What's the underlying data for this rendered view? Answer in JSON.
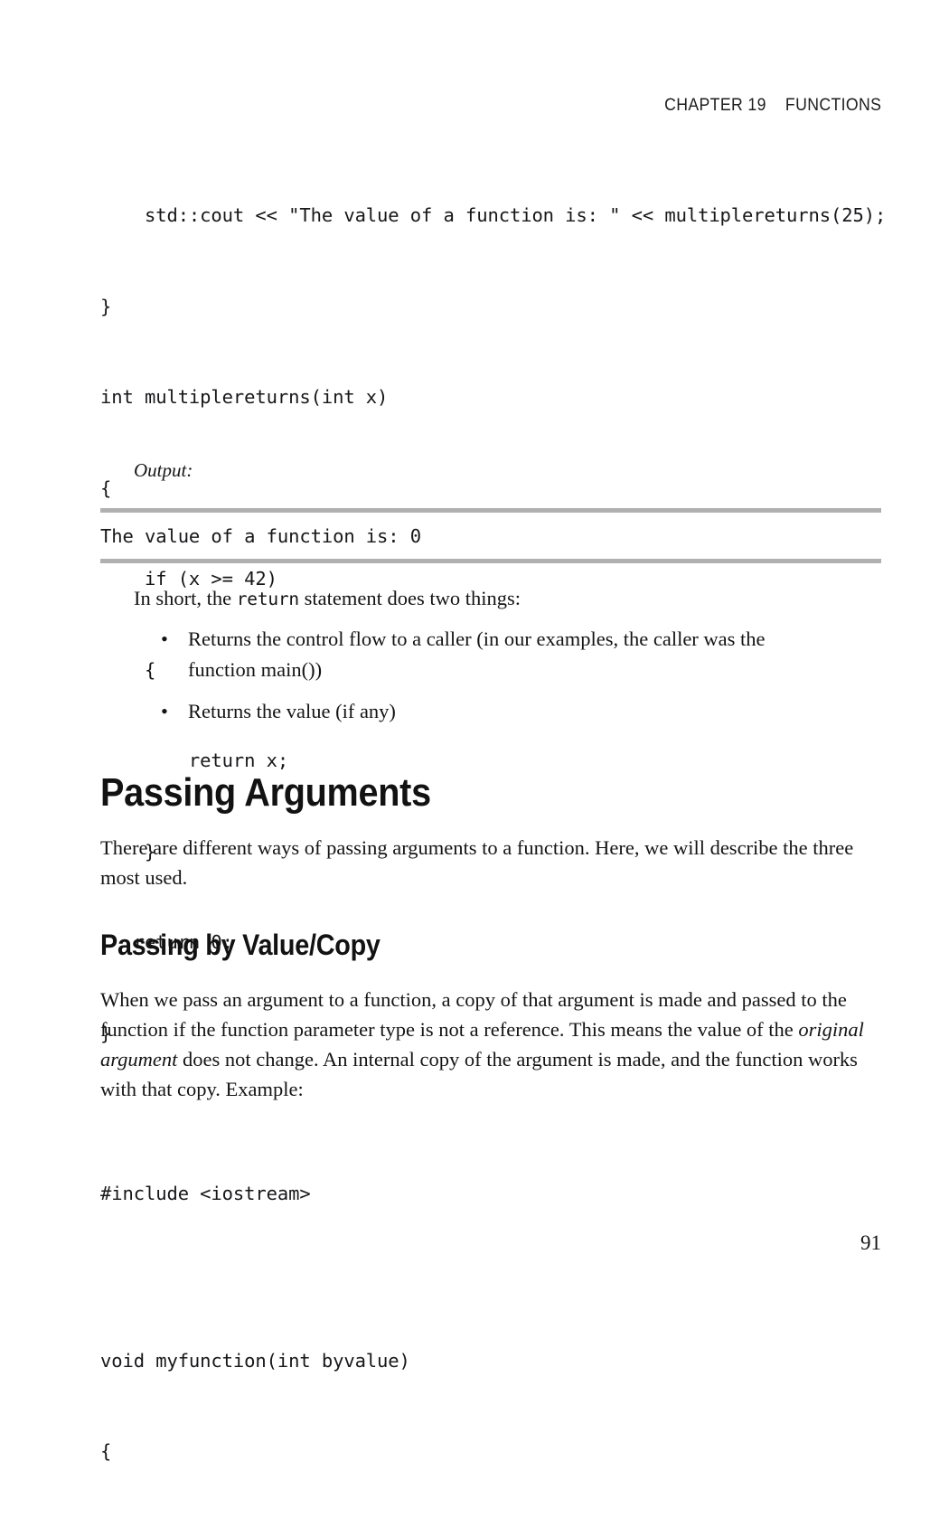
{
  "header": {
    "chapter_label": "CHAPTER 19",
    "chapter_title": "FUNCTIONS",
    "combined": "CHAPTER 19    FUNCTIONS"
  },
  "code_top": {
    "lines": [
      "    std::cout << \"The value of a function is: \" << multiplereturns(25);",
      "}",
      "int multiplereturns(int x)",
      "{",
      "    if (x >= 42)",
      "    {",
      "        return x;",
      "    }",
      "   return 0;",
      "}"
    ]
  },
  "output_section": {
    "label": "Output:",
    "console_text": "The value of a function is: 0",
    "rule_color": "#b0b0b0"
  },
  "intro_paragraph": {
    "before": "In short, the ",
    "code": "return",
    "after": " statement does two things:"
  },
  "bullets": {
    "marker": "•",
    "items": [
      "Returns the control flow to a caller (in our examples, the caller was the function main())",
      "Returns the value (if any)"
    ]
  },
  "section_heading": "Passing Arguments",
  "section_paragraph": "There are different ways of passing arguments to a function. Here, we will describe the three most used.",
  "subsection_heading": "Passing by Value/Copy",
  "subsection_paragraph": {
    "part1": "When we pass an argument to a function, a copy of that argument is made and passed to the function if the function parameter type is not a reference. This means the value of the ",
    "emphasis": "original argument",
    "part2": " does not change. An internal copy of the argument is made, and the function works with that copy. Example:"
  },
  "code_bottom": {
    "line1": "#include <iostream>",
    "line2": "void myfunction(int byvalue)",
    "line3": "{"
  },
  "folio": "91"
}
